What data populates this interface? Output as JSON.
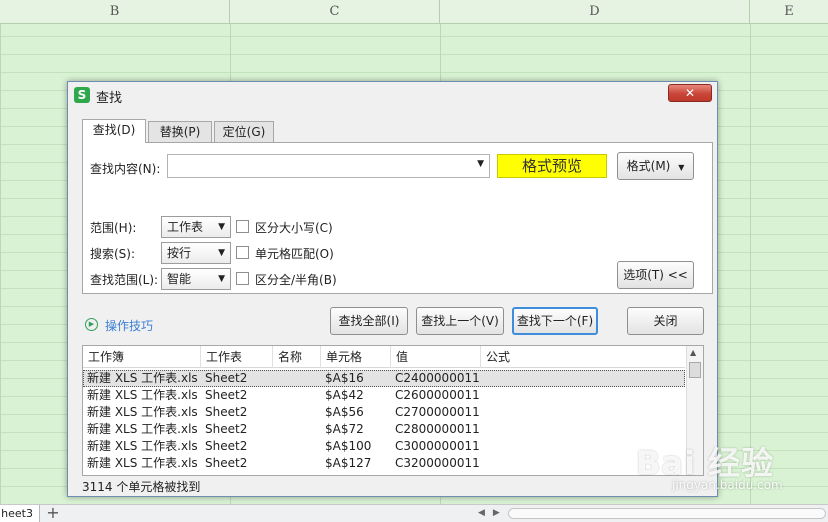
{
  "spreadsheet": {
    "columns": [
      "B",
      "C",
      "D",
      "E"
    ],
    "sheet_tab": "heet3",
    "add_sheet": "+"
  },
  "dialog": {
    "title": "查找",
    "app_icon": "S",
    "close": "✕",
    "tabs": [
      {
        "label": "查找(D)",
        "active": true
      },
      {
        "label": "替换(P)",
        "active": false
      },
      {
        "label": "定位(G)",
        "active": false
      }
    ],
    "find_label": "查找内容(N):",
    "find_value": "",
    "format_preview": "格式预览",
    "format_button": "格式(M)",
    "scope_label": "范围(H):",
    "scope_value": "工作表",
    "search_label": "搜索(S):",
    "search_value": "按行",
    "lookin_label": "查找范围(L):",
    "lookin_value": "智能",
    "match_case": "区分大小写(C)",
    "match_cell": "单元格匹配(O)",
    "match_width": "区分全/半角(B)",
    "options_button": "选项(T) <<",
    "tips_link": "操作技巧",
    "find_all": "查找全部(I)",
    "find_prev": "查找上一个(V)",
    "find_next": "查找下一个(F)",
    "close_button": "关闭",
    "results": {
      "headers": [
        "工作簿",
        "工作表",
        "名称",
        "单元格",
        "值",
        "公式"
      ],
      "rows": [
        [
          "新建 XLS 工作表.xls",
          "Sheet2",
          "",
          "$A$16",
          "C2400000011",
          ""
        ],
        [
          "新建 XLS 工作表.xls",
          "Sheet2",
          "",
          "$A$42",
          "C2600000011",
          ""
        ],
        [
          "新建 XLS 工作表.xls",
          "Sheet2",
          "",
          "$A$56",
          "C2700000011",
          ""
        ],
        [
          "新建 XLS 工作表.xls",
          "Sheet2",
          "",
          "$A$72",
          "C2800000011",
          ""
        ],
        [
          "新建 XLS 工作表.xls",
          "Sheet2",
          "",
          "$A$100",
          "C3000000011",
          ""
        ],
        [
          "新建 XLS 工作表.xls",
          "Sheet2",
          "",
          "$A$127",
          "C3200000011",
          ""
        ]
      ],
      "status": "3114 个单元格被找到"
    }
  },
  "watermark": {
    "text": "Bai 经验",
    "sub": "jingyan.baidu.com"
  }
}
